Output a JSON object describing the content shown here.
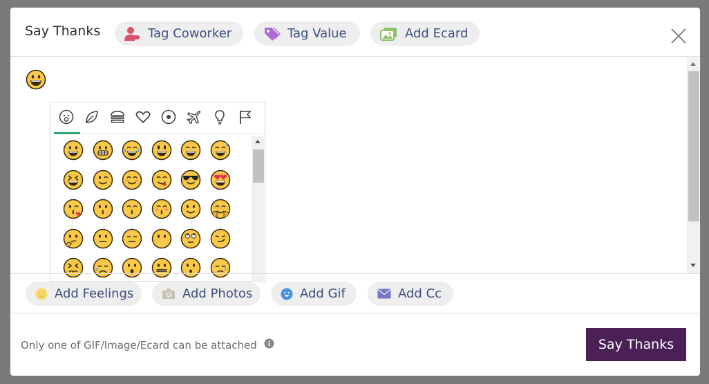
{
  "modal": {
    "title": "Say Thanks"
  },
  "header": {
    "tag_coworker_label": "Tag Coworker",
    "tag_value_label": "Tag Value",
    "add_ecard_label": "Add Ecard"
  },
  "editor": {
    "content_emoji": "grinning-face"
  },
  "emoji_picker": {
    "categories": [
      "smileys",
      "nature",
      "food",
      "symbols",
      "activity",
      "travel",
      "objects",
      "flags"
    ],
    "active_category": "smileys",
    "emojis": [
      "grinning",
      "grimacing",
      "joy",
      "grinning-big-eyes",
      "smile",
      "sweat-smile",
      "laughing",
      "wink",
      "blush",
      "yum",
      "sunglasses",
      "heart-eyes",
      "kissing-heart",
      "kissing",
      "kissing-smiling-eyes",
      "kissing-closed-eyes",
      "slight-smile",
      "hugging",
      "thinking",
      "neutral",
      "expressionless",
      "no-mouth",
      "rolling-eyes",
      "smirk",
      "persevere",
      "disappointed-relieved",
      "open-mouth",
      "zipper-mouth",
      "hushed",
      "sleepy"
    ]
  },
  "toolbar": {
    "add_feelings_label": "Add Feelings",
    "add_photos_label": "Add Photos",
    "add_gif_label": "Add Gif",
    "add_cc_label": "Add Cc"
  },
  "footer": {
    "note": "Only one of GIF/Image/Ecard can be attached",
    "submit_label": "Say Thanks"
  },
  "colors": {
    "submit_bg": "#4a2056",
    "link_text": "#3c4f7d",
    "pill_bg": "#eeeeee",
    "tag_coworker_icon": "#d9536f",
    "tag_value_icon": "#b06ad6",
    "add_ecard_icon": "#8dc26a",
    "active_tab": "#2aa66f",
    "emoji_face": "#f7c84a"
  }
}
